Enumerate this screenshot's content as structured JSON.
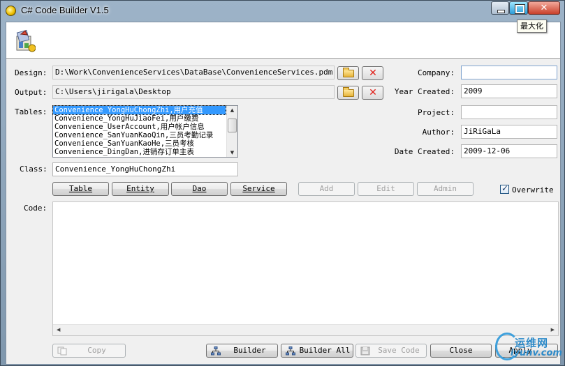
{
  "window": {
    "title": "C# Code Builder V1.5",
    "maximize_tooltip": "最大化",
    "close_glyph": "✕"
  },
  "labels": {
    "design": "Design:",
    "output": "Output:",
    "tables": "Tables:",
    "class": "Class:",
    "code": "Code:",
    "company": "Company:",
    "year_created": "Year Created:",
    "project": "Project:",
    "author": "Author:",
    "date_created": "Date Created:"
  },
  "fields": {
    "design": "D:\\Work\\ConvenienceServices\\DataBase\\ConvenienceServices.pdm",
    "output": "C:\\Users\\jirigala\\Desktop",
    "class": "Convenience_YongHuChongZhi",
    "company": "",
    "year_created": "2009",
    "project": "",
    "author": "JiRiGaLa",
    "date_created": "2009-12-06",
    "code": ""
  },
  "tables": [
    {
      "label": "Convenience_YongHuChongZhi,用户充值",
      "selected": true
    },
    {
      "label": "Convenience_YongHuJiaoFei,用户缴费",
      "selected": false
    },
    {
      "label": "Convenience_UserAccount,用户帐户信息",
      "selected": false
    },
    {
      "label": "Convenience_SanYuanKaoQin,三员考勤记录",
      "selected": false
    },
    {
      "label": "Convenience_SanYuanKaoHe,三员考核",
      "selected": false
    },
    {
      "label": "Convenience_DingDan,进销存订单主表",
      "selected": false
    }
  ],
  "tabs": {
    "table": "Table",
    "entity": "Entity",
    "dao": "Dao",
    "service": "Service"
  },
  "actions": {
    "add": "Add",
    "edit": "Edit",
    "admin": "Admin",
    "overwrite": "Overwrite",
    "overwrite_checked": true
  },
  "footer": {
    "copy": "Copy",
    "builder": "Builder",
    "builder_all": "Builder All",
    "save_code": "Save Code",
    "close": "Close",
    "apply": "Apply"
  },
  "watermark": {
    "cn": "运维网",
    "url": "iyunv.com"
  },
  "icons": {
    "app": "app-icon",
    "banner": "toolbox-icon",
    "browse": "folder-open-icon",
    "clear": "red-x-icon"
  },
  "colors": {
    "selection": "#3399ff",
    "clear_icon": "#e0201a",
    "titlebar_close": "#c9412b"
  }
}
